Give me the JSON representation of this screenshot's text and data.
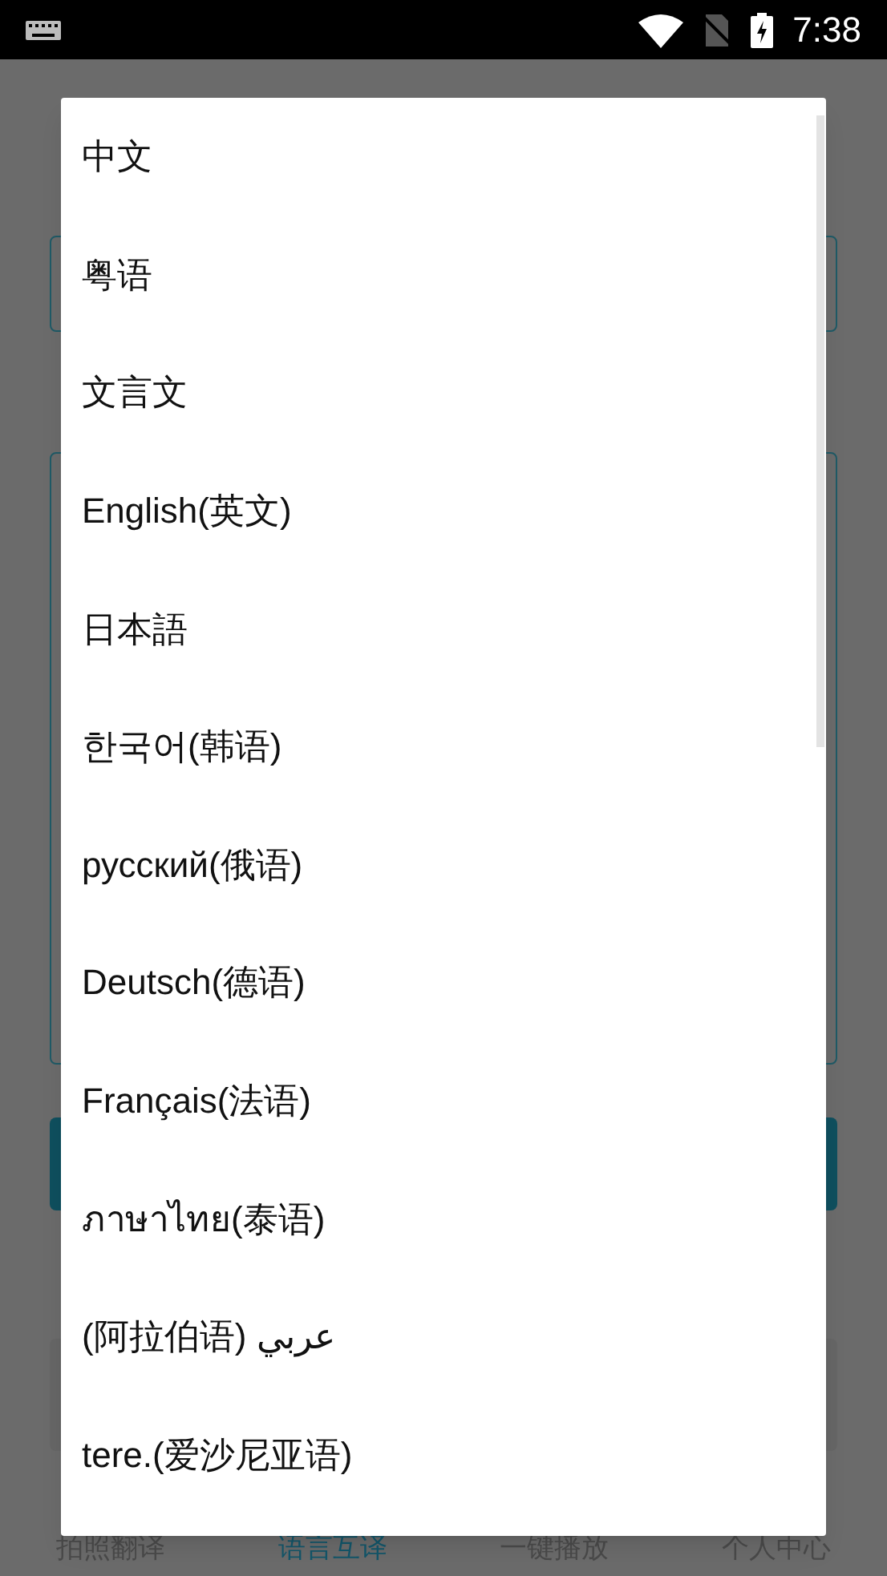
{
  "status_bar": {
    "time": "7:38"
  },
  "dialog": {
    "options": [
      {
        "label": "中文"
      },
      {
        "label": "粤语"
      },
      {
        "label": "文言文"
      },
      {
        "label": "English(英文)"
      },
      {
        "label": "日本語"
      },
      {
        "label": "한국어(韩语)"
      },
      {
        "label": "русский(俄语)"
      },
      {
        "label": "Deutsch(德语)"
      },
      {
        "label": "Français(法语)"
      },
      {
        "label": "ภาษาไทย(泰语)"
      },
      {
        "label": "(阿拉伯语) عربي"
      },
      {
        "label": "tere.(爱沙尼亚语)"
      }
    ]
  },
  "bottom_nav": [
    {
      "label": "拍照翻译",
      "selected": false
    },
    {
      "label": "语言互译",
      "selected": true
    },
    {
      "label": "一键播放",
      "selected": false
    },
    {
      "label": "个人中心",
      "selected": false
    }
  ]
}
